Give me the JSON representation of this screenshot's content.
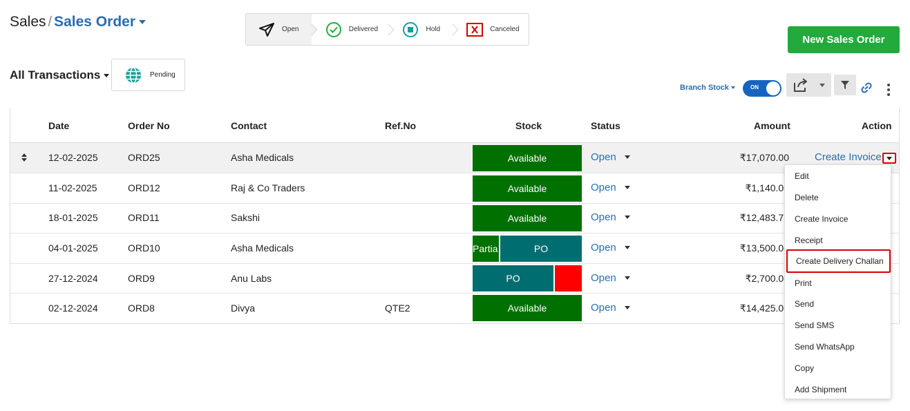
{
  "breadcrumb": {
    "root": "Sales",
    "separator": "/",
    "current": "Sales Order"
  },
  "status_steps": [
    {
      "label": "Open",
      "icon": "paper-plane-icon"
    },
    {
      "label": "Delivered",
      "icon": "check-circle-icon"
    },
    {
      "label": "Hold",
      "icon": "stop-circle-icon"
    },
    {
      "label": "Canceled",
      "icon": "x-box-icon"
    }
  ],
  "toolbar": {
    "new_button": "New Sales Order",
    "filter_view": "All Transactions",
    "pending_label": "Pending",
    "branch_stock": "Branch Stock",
    "toggle_label": "ON"
  },
  "table": {
    "headers": [
      "Date",
      "Order No",
      "Contact",
      "Ref.No",
      "Stock",
      "Status",
      "Amount",
      "Action"
    ],
    "rows": [
      {
        "date": "12-02-2025",
        "order_no": "ORD25",
        "contact": "Asha Medicals",
        "ref": "",
        "stock": [
          {
            "label": "Available",
            "kind": "available"
          }
        ],
        "status": "Open",
        "amount": "₹17,070.00",
        "action": "Create Invoice"
      },
      {
        "date": "11-02-2025",
        "order_no": "ORD12",
        "contact": "Raj & Co Traders",
        "ref": "",
        "stock": [
          {
            "label": "Available",
            "kind": "available"
          }
        ],
        "status": "Open",
        "amount": "₹1,140.00",
        "action": ""
      },
      {
        "date": "18-01-2025",
        "order_no": "ORD11",
        "contact": "Sakshi",
        "ref": "",
        "stock": [
          {
            "label": "Available",
            "kind": "available"
          }
        ],
        "status": "Open",
        "amount": "₹12,483.75",
        "action": ""
      },
      {
        "date": "04-01-2025",
        "order_no": "ORD10",
        "contact": "Asha Medicals",
        "ref": "",
        "stock": [
          {
            "label": "Partia",
            "kind": "partial"
          },
          {
            "label": "PO",
            "kind": "po"
          }
        ],
        "status": "Open",
        "amount": "₹13,500.00",
        "action": ""
      },
      {
        "date": "27-12-2024",
        "order_no": "ORD9",
        "contact": "Anu Labs",
        "ref": "",
        "stock": [
          {
            "label": "PO",
            "kind": "po"
          },
          {
            "label": "",
            "kind": "red"
          }
        ],
        "status": "Open",
        "amount": "₹2,700.00",
        "action": ""
      },
      {
        "date": "02-12-2024",
        "order_no": "ORD8",
        "contact": "Divya",
        "ref": "QTE2",
        "stock": [
          {
            "label": "Available",
            "kind": "available"
          }
        ],
        "status": "Open",
        "amount": "₹14,425.00",
        "action": ""
      }
    ]
  },
  "action_menu": {
    "items": [
      "Edit",
      "Delete",
      "Create Invoice",
      "Receipt",
      "Create Delivery Challan",
      "Print",
      "Send",
      "Send SMS",
      "Send WhatsApp",
      "Copy",
      "Add Shipment"
    ],
    "selected": "Create Delivery Challan"
  },
  "colors": {
    "accent_blue": "#2b6cb0",
    "new_button_green": "#22aa3c",
    "stock_available": "#007000",
    "stock_po": "#006e70",
    "stock_out": "#ff0000",
    "highlight_red": "#d40000"
  }
}
